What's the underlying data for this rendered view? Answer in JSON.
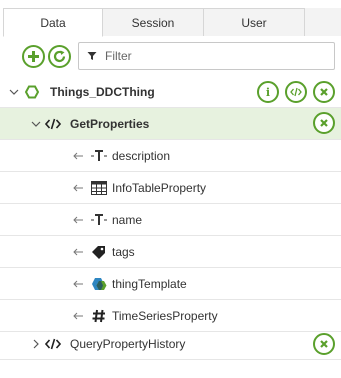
{
  "tabs": [
    "Data",
    "Session",
    "User"
  ],
  "toolbar": {
    "add_icon": "plus-icon",
    "refresh_icon": "refresh-icon",
    "filter_icon": "funnel-icon",
    "filter_placeholder": "Filter"
  },
  "tree": {
    "root": {
      "label": "Things_DDCThing",
      "actions": [
        "info-icon",
        "code-icon",
        "close-icon"
      ]
    },
    "get_properties": {
      "label": "GetProperties"
    },
    "properties": [
      {
        "label": "description",
        "icon": "string-type-icon"
      },
      {
        "label": "InfoTableProperty",
        "icon": "infotable-type-icon"
      },
      {
        "label": "name",
        "icon": "string-type-icon"
      },
      {
        "label": "tags",
        "icon": "tag-icon"
      },
      {
        "label": "thingTemplate",
        "icon": "thingtemplate-icon"
      },
      {
        "label": "TimeSeriesProperty",
        "icon": "hash-icon"
      }
    ],
    "query_history": {
      "label": "QueryPropertyHistory"
    }
  },
  "colors": {
    "accent": "#5aa02c",
    "selected_row": "#e7f2df"
  }
}
